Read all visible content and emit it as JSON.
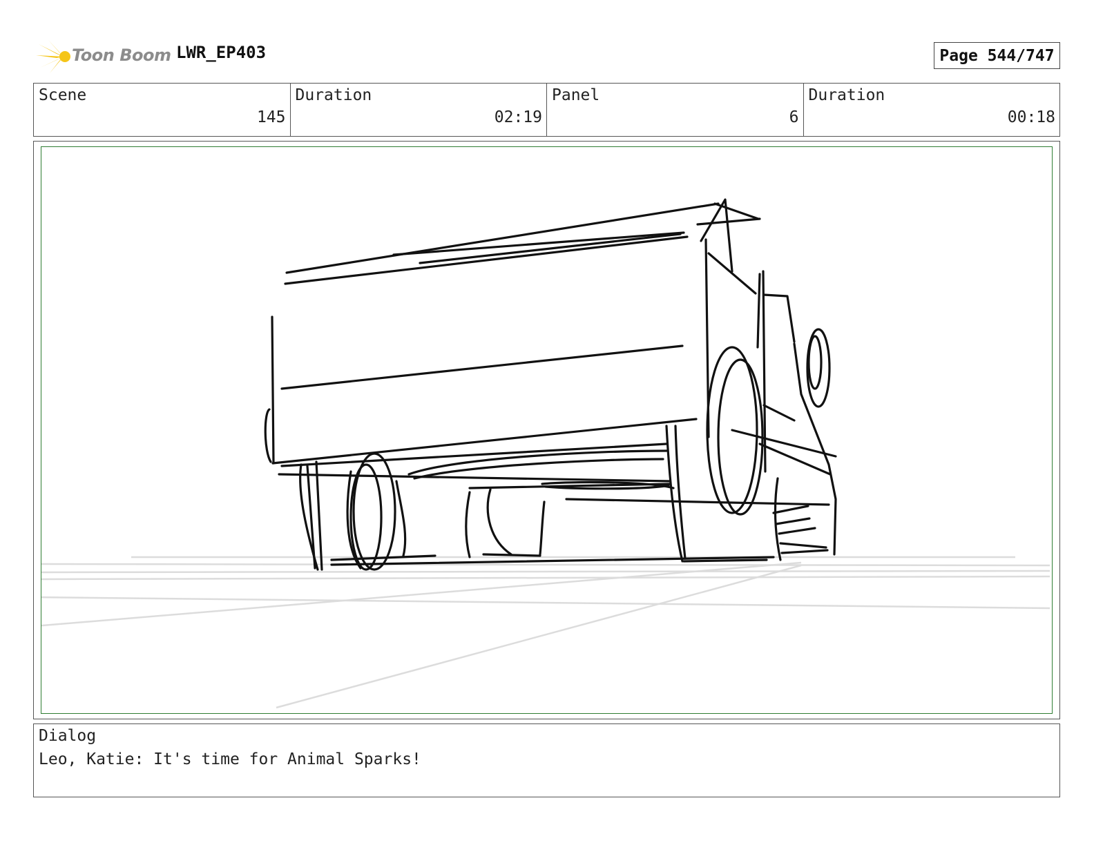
{
  "header": {
    "logo_text": "Toon Boom",
    "episode": "LWR_EP403",
    "page_label": "Page 544/747"
  },
  "info": [
    {
      "label": "Scene",
      "value": "145"
    },
    {
      "label": "Duration",
      "value": "02:19"
    },
    {
      "label": "Panel",
      "value": "6"
    },
    {
      "label": "Duration",
      "value": "00:18"
    }
  ],
  "panel": {
    "frame_color": "#2e7d32",
    "sketch_subject": "truck-sketch"
  },
  "dialog": {
    "label": "Dialog",
    "text": "Leo, Katie: It's time for Animal Sparks!"
  },
  "colors": {
    "logo_star": "#f5c518",
    "logo_text": "#8c8c8c"
  }
}
